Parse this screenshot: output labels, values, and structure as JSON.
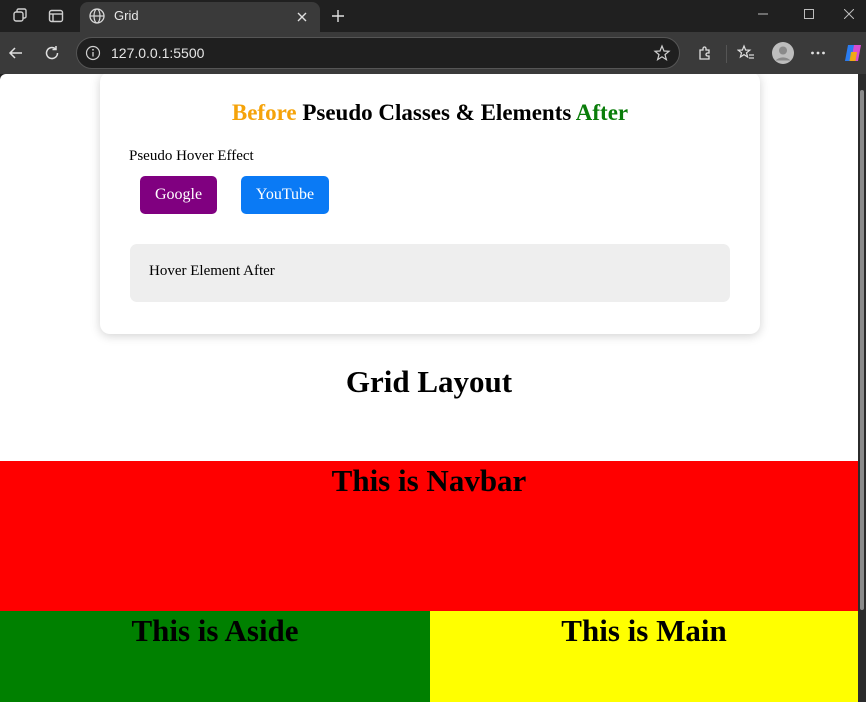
{
  "browser": {
    "tab_title": "Grid",
    "url": "127.0.0.1:5500",
    "icons": [
      "workspaces-icon",
      "tab-actions-icon",
      "globe-icon",
      "close-icon",
      "new-tab-icon",
      "back-icon",
      "refresh-icon",
      "info-icon",
      "favorite-star-icon",
      "extensions-icon",
      "favorites-icon",
      "profile-icon",
      "more-icon",
      "copilot-icon",
      "minimize-icon",
      "maximize-icon",
      "window-close-icon"
    ]
  },
  "page": {
    "card": {
      "title_before": "Before",
      "title_middle": " Pseudo Classes & Elements ",
      "title_after": "After",
      "hover_label": "Pseudo Hover Effect",
      "google_button": "Google",
      "youtube_button": "YouTube",
      "hover_box_text": "Hover Element After"
    },
    "grid_heading": "Grid Layout",
    "navbar_text": "This is Navbar",
    "aside_text": "This is Aside",
    "main_text": "This is Main"
  },
  "colors": {
    "before": "#f5a30a",
    "after": "#0a7d0a",
    "google": "#800080",
    "youtube": "#0a7af5",
    "navbar": "#ff0000",
    "aside": "#008000",
    "main": "#ffff00"
  }
}
